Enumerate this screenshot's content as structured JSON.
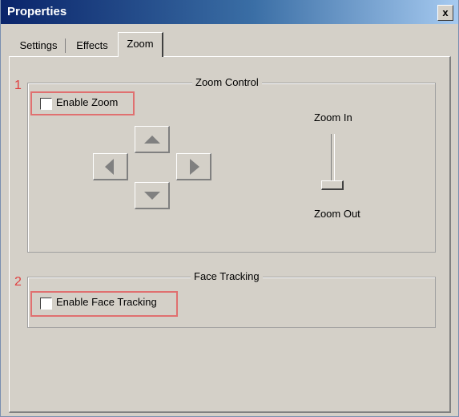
{
  "window": {
    "title": "Properties",
    "close_symbol": "x"
  },
  "tabs": [
    {
      "label": "Settings"
    },
    {
      "label": "Effects"
    },
    {
      "label": "Zoom",
      "active": true
    }
  ],
  "zoom_control": {
    "title": "Zoom Control",
    "marker": "1",
    "enable_label": "Enable Zoom",
    "enabled": false,
    "zoom_in_label": "Zoom In",
    "zoom_out_label": "Zoom Out",
    "slider_level": 0
  },
  "face_tracking": {
    "title": "Face Tracking",
    "marker": "2",
    "enable_label": "Enable Face Tracking",
    "enabled": false
  },
  "colors": {
    "highlight": "#e07070",
    "marker": "#e04040",
    "titlebar": "#0a246a",
    "background": "#d4d0c8"
  }
}
